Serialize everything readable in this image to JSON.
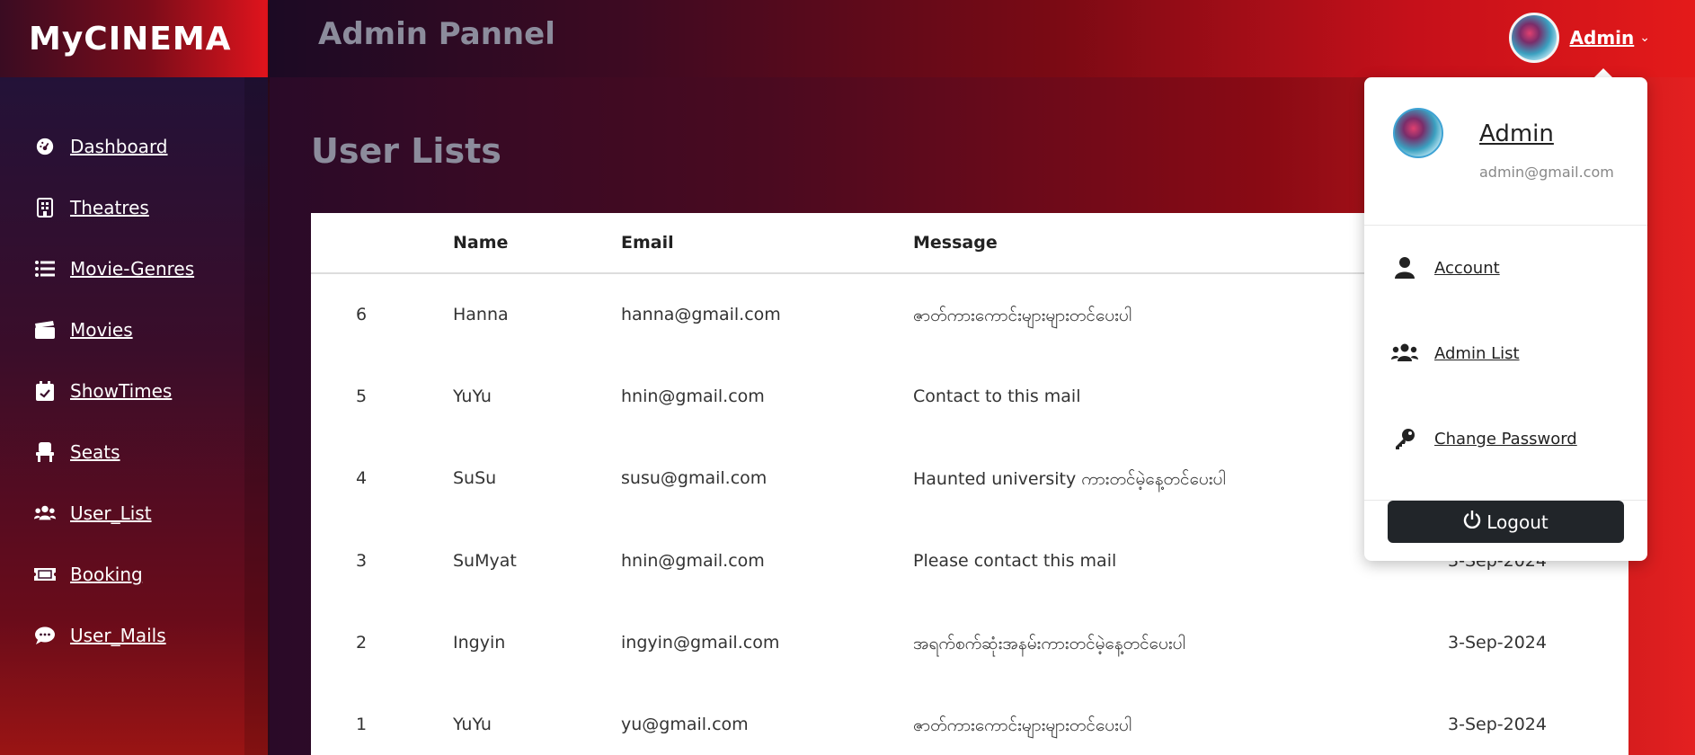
{
  "brand": {
    "logo_text": "MyCINEMA"
  },
  "header": {
    "title": "Admin Pannel",
    "user_name": "Admin",
    "caret": "⌄"
  },
  "sidebar": {
    "items": [
      {
        "label": "Dashboard",
        "icon": "dashboard-icon"
      },
      {
        "label": "Theatres",
        "icon": "building-icon"
      },
      {
        "label": "Movie-Genres",
        "icon": "list-icon"
      },
      {
        "label": "Movies",
        "icon": "clapperboard-icon"
      },
      {
        "label": "ShowTimes",
        "icon": "calendar-check-icon"
      },
      {
        "label": "Seats",
        "icon": "chair-icon"
      },
      {
        "label": "User_List",
        "icon": "users-icon"
      },
      {
        "label": "Booking",
        "icon": "ticket-icon"
      },
      {
        "label": "User_Mails",
        "icon": "comment-icon"
      }
    ]
  },
  "main": {
    "title": "User Lists",
    "columns": [
      "Name",
      "Email",
      "Message"
    ],
    "rows": [
      {
        "id": "6",
        "name": "Hanna",
        "email": "hanna@gmail.com",
        "message": "ဇာတ်ကားကောင်းများများတင်ပေးပါ",
        "date": ""
      },
      {
        "id": "5",
        "name": "YuYu",
        "email": "hnin@gmail.com",
        "message": "Contact to this mail",
        "date": ""
      },
      {
        "id": "4",
        "name": "SuSu",
        "email": "susu@gmail.com",
        "message": "Haunted university ကားတင်မဲ့နေ့တင်ပေးပါ",
        "date": ""
      },
      {
        "id": "3",
        "name": "SuMyat",
        "email": "hnin@gmail.com",
        "message": "Please contact this mail",
        "date": "3-Sep-2024"
      },
      {
        "id": "2",
        "name": "Ingyin",
        "email": "ingyin@gmail.com",
        "message": "အရက်စက်ဆုံးအနမ်းကားတင်မဲ့နေ့တင်ပေးပါ",
        "date": "3-Sep-2024"
      },
      {
        "id": "1",
        "name": "YuYu",
        "email": "yu@gmail.com",
        "message": "ဇာတ်ကားကောင်းများများတင်ပေးပါ",
        "date": "3-Sep-2024"
      }
    ]
  },
  "dropdown": {
    "name": "Admin",
    "email": "admin@gmail.com",
    "items": [
      {
        "label": "Account",
        "icon": "user-icon"
      },
      {
        "label": "Admin List",
        "icon": "users-icon"
      },
      {
        "label": "Change Password",
        "icon": "key-icon"
      }
    ],
    "logout_label": "Logout"
  },
  "colors": {
    "accent_red": "#e41a1a",
    "dark_purple": "#231238",
    "logout_bg": "#212529"
  }
}
